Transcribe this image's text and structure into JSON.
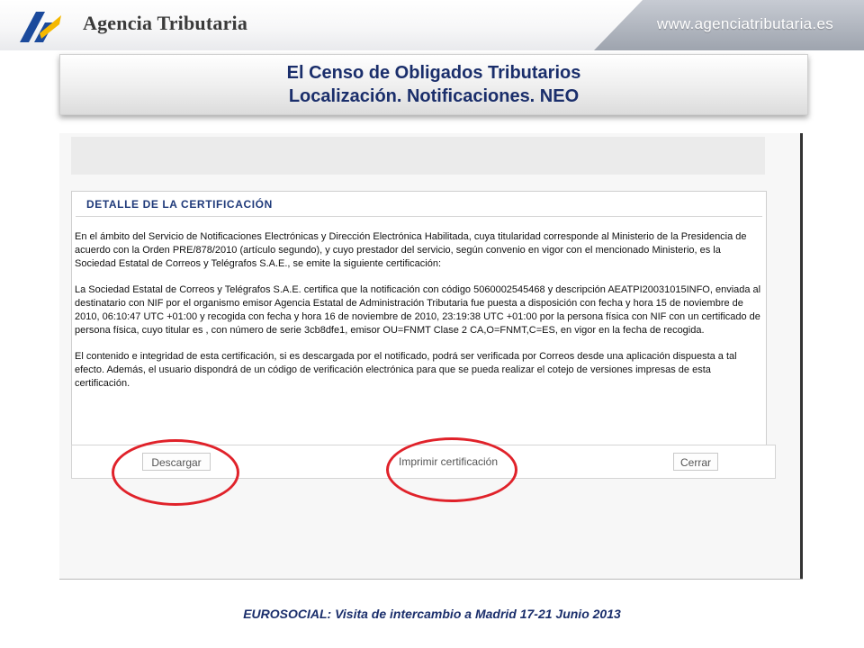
{
  "header": {
    "brand": "Agencia Tributaria",
    "website": "www.agenciatributaria.es"
  },
  "title": {
    "line1": "El Censo de Obligados Tributarios",
    "line2": "Localización. Notificaciones. NEO"
  },
  "certificate": {
    "heading": "DETALLE DE LA CERTIFICACIÓN",
    "paragraph1": "En el ámbito del Servicio de Notificaciones Electrónicas y Dirección Electrónica Habilitada, cuya titularidad corresponde al Ministerio de la Presidencia de acuerdo con la Orden PRE/878/2010 (artículo segundo), y cuyo prestador del servicio, según convenio en vigor con el mencionado Ministerio, es la Sociedad Estatal de Correos y Telégrafos S.A.E., se emite la siguiente certificación:",
    "paragraph2": "La Sociedad Estatal de Correos y Telégrafos S.A.E. certifica que la notificación con código 5060002545468 y descripción AEATPI20031015INFO, enviada al destinatario con NIF                 por el organismo emisor Agencia Estatal de Administración Tributaria fue puesta a disposición con fecha y hora 15 de noviembre de 2010, 06:10:47 UTC +01:00 y recogida con fecha y hora 16 de noviembre de 2010, 23:19:38 UTC +01:00 por la persona física                          con NIF                  con un certificado de persona física, cuyo titular es                                                  , con número de serie 3cb8dfe1, emisor OU=FNMT Clase 2 CA,O=FNMT,C=ES, en vigor en la fecha de recogida.",
    "paragraph3": "El contenido e integridad de esta certificación, si es descargada por el notificado, podrá ser verificada por Correos desde una aplicación dispuesta a tal efecto. Además, el usuario dispondrá de un código de verificación electrónica para que se pueda realizar el cotejo de versiones impresas de esta certificación."
  },
  "buttons": {
    "download": "Descargar",
    "print": "Imprimir certificación",
    "close": "Cerrar"
  },
  "footer": {
    "text": "EUROSOCIAL: Visita de intercambio a Madrid 17-21 Junio 2013"
  },
  "colors": {
    "title_text": "#1a2e6b",
    "highlight_circle": "#e0222a",
    "logo_blue": "#1b4a9c",
    "logo_yellow": "#f5b800"
  }
}
